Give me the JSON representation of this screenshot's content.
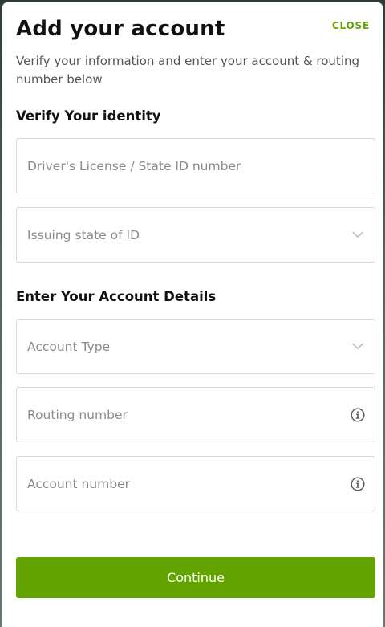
{
  "header": {
    "title": "Add your account",
    "close_label": "CLOSE",
    "subtitle": "Verify your information and enter your account & routing number below"
  },
  "identity_section": {
    "title": "Verify Your identity",
    "license_placeholder": "Driver's License / State ID number",
    "state_placeholder": "Issuing state of ID"
  },
  "account_section": {
    "title": "Enter Your Account Details",
    "account_type_placeholder": "Account Type",
    "routing_placeholder": "Routing number",
    "account_number_placeholder": "Account number"
  },
  "footer": {
    "continue_label": "Continue"
  },
  "icons": {
    "chevron": "chevron-down-icon",
    "info": "info-icon"
  },
  "colors": {
    "accent": "#62a300",
    "backdrop": "#3a4a3e"
  }
}
